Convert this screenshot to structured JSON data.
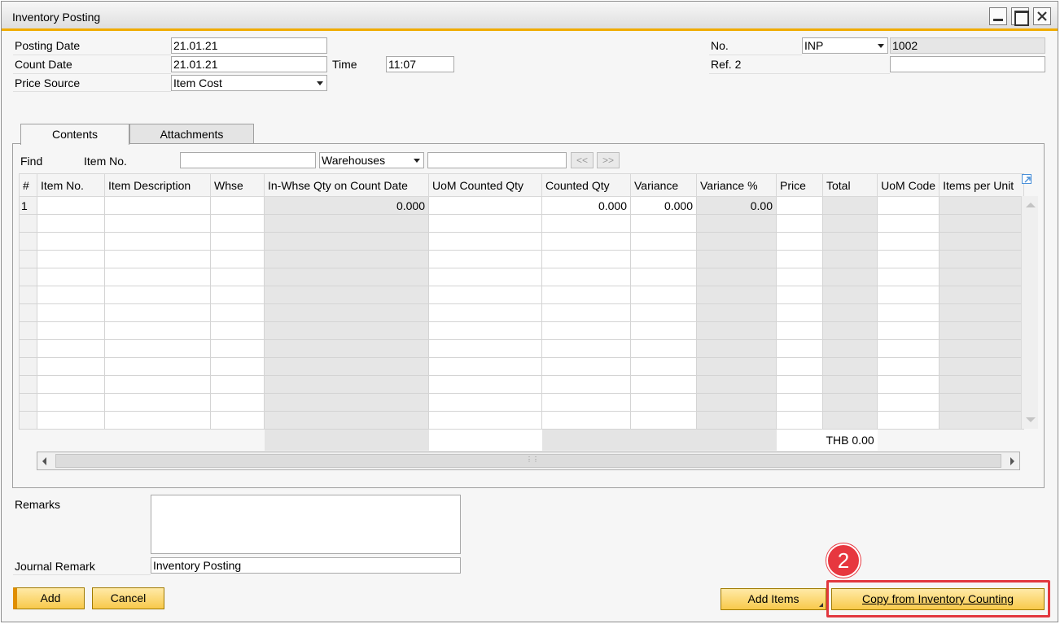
{
  "window": {
    "title": "Inventory Posting"
  },
  "header": {
    "posting_date_label": "Posting Date",
    "posting_date": "21.01.21",
    "count_date_label": "Count Date",
    "count_date": "21.01.21",
    "time_label": "Time",
    "time": "11:07",
    "price_source_label": "Price Source",
    "price_source": "Item Cost",
    "no_label": "No.",
    "no_series": "INP",
    "no_value": "1002",
    "ref2_label": "Ref. 2",
    "ref2_value": ""
  },
  "tabs": [
    {
      "label": "Contents",
      "active": true
    },
    {
      "label": "Attachments",
      "active": false
    }
  ],
  "find": {
    "label": "Find",
    "item_no_label": "Item No.",
    "item_no_value": "",
    "warehouses": "Warehouses",
    "search_value": "",
    "prev_label": "<<",
    "next_label": ">>"
  },
  "grid": {
    "columns": [
      "#",
      "Item No.",
      "Item Description",
      "Whse",
      "In-Whse Qty on Count Date",
      "UoM Counted Qty",
      "Counted Qty",
      "Variance",
      "Variance %",
      "Price",
      "Total",
      "UoM Code",
      "Items per Unit"
    ],
    "row1": {
      "num": "1",
      "in_whse_qty": "0.000",
      "counted_qty": "0.000",
      "variance": "0.000",
      "variance_pct": "0.00"
    },
    "total": "THB 0.00"
  },
  "footer": {
    "remarks_label": "Remarks",
    "journal_remark_label": "Journal Remark",
    "journal_remark": "Inventory Posting"
  },
  "buttons": {
    "add": "Add",
    "cancel": "Cancel",
    "add_items": "Add Items",
    "copy_from": "Copy from Inventory Counting"
  },
  "annotation": {
    "step": "2",
    "color": "#e2383f"
  },
  "colors": {
    "accent": "#f0ab00",
    "button": "#f8c94b"
  }
}
